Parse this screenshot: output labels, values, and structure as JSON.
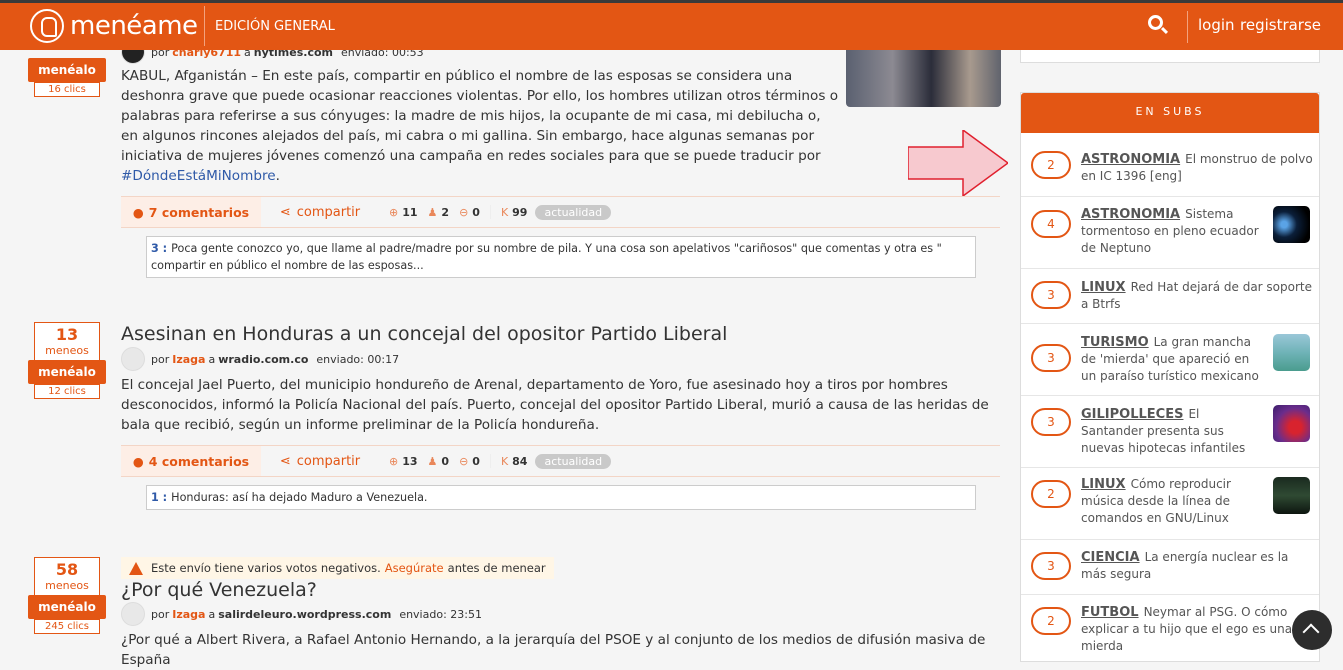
{
  "header": {
    "logo_text": "menéame",
    "edition": "EDICIÓN GENERAL",
    "login": "login",
    "register": "registrarse"
  },
  "stories": [
    {
      "menealo": "menéalo",
      "clicks": "16 clics",
      "meta_by": "por",
      "user": "charly6711",
      "to": "a",
      "site": "nytimes.com",
      "sent": "enviado: 00:53",
      "body": "KABUL, Afganistán – En este país, compartir en público el nombre de las esposas se considera una deshonra grave que puede ocasionar reacciones violentas. Por ello, los hombres utilizan otros términos o palabras para referirse a sus cónyuges: la madre de mis hijos, la ocupante de mi casa, mi debilucha o, en algunos rincones alejados del país, mi cabra o mi gallina. Sin embargo, hace algunas semanas por iniciativa de mujeres jóvenes comenzó una campaña en redes sociales para que se puede traducir por",
      "hashtag": "#DóndeEstáMiNombre",
      "after_hashtag": ".",
      "comments": "7 comentarios",
      "share": "compartir",
      "up": "11",
      "anon": "2",
      "neg": "0",
      "karma_label": "K",
      "karma": "99",
      "category": "actualidad",
      "excerpt_num": "3 :",
      "excerpt": "Poca gente conozco yo, que llame al padre/madre por su nombre de pila. Y una cosa son apelativos \"cariñosos\" que comentas y otra es \" compartir en público el nombre de las esposas..."
    },
    {
      "votes": "13",
      "votes_label": "meneos",
      "menealo": "menéalo",
      "clicks": "12 clics",
      "title": "Asesinan en Honduras a un concejal del opositor Partido Liberal",
      "meta_by": "por",
      "user": "Izaga",
      "to": "a",
      "site": "wradio.com.co",
      "sent": "enviado: 00:17",
      "body": "El concejal Jael Puerto, del municipio hondureño de Arenal, departamento de Yoro, fue asesinado hoy a tiros por hombres desconocidos, informó la Policía Nacional del país. Puerto, concejal del opositor Partido Liberal, murió a causa de las heridas de bala que recibió, según un informe preliminar de la Policía hondureña.",
      "comments": "4 comentarios",
      "share": "compartir",
      "up": "13",
      "anon": "0",
      "neg": "0",
      "karma_label": "K",
      "karma": "84",
      "category": "actualidad",
      "excerpt_num": "1 :",
      "excerpt": "Honduras: así ha dejado Maduro a Venezuela."
    },
    {
      "votes": "58",
      "votes_label": "meneos",
      "menealo": "menéalo",
      "clicks": "245 clics",
      "warning_pre": "Este envío tiene varios votos negativos.",
      "warning_link": "Asegúrate",
      "warning_post": "antes de menear",
      "title": "¿Por qué Venezuela?",
      "meta_by": "por",
      "user": "Izaga",
      "to": "a",
      "site": "salirdeleuro.wordpress.com",
      "sent": "enviado: 23:51",
      "body": "¿Por qué a Albert Rivera, a Rafael Antonio Hernando, a la jerarquía del PSOE y al conjunto de los medios de difusión masiva de España"
    }
  ],
  "sidebar": {
    "subs_title": "EN SUBS",
    "items": [
      {
        "count": "2",
        "sub": "ASTRONOMIA",
        "text": "El monstruo de polvo en IC 1396 [eng]"
      },
      {
        "count": "4",
        "sub": "ASTRONOMIA",
        "text": "Sistema tormentoso en pleno ecuador de Neptuno"
      },
      {
        "count": "3",
        "sub": "LINUX",
        "text": "Red Hat dejará de dar soporte a Btrfs"
      },
      {
        "count": "3",
        "sub": "TURISMO",
        "text": "La gran mancha de 'mierda' que apareció en un paraíso turístico mexicano"
      },
      {
        "count": "3",
        "sub": "GILIPOLLECES",
        "text": "El Santander presenta sus nuevas hipotecas infantiles"
      },
      {
        "count": "2",
        "sub": "LINUX",
        "text": "Cómo reproducir música desde la línea de comandos en GNU/Linux"
      },
      {
        "count": "3",
        "sub": "CIENCIA",
        "text": "La energía nuclear es la más segura"
      },
      {
        "count": "2",
        "sub": "FUTBOL",
        "text": "Neymar al PSG. O cómo explicar a tu hijo que el ego es una mierda"
      }
    ]
  },
  "icons": {
    "comments": "speech-bubble-icon",
    "share": "share-icon",
    "up": "arrow-up-circle-icon",
    "anon": "anonymous-user-icon",
    "neg": "arrow-down-circle-icon",
    "warning": "warning-triangle-icon",
    "search": "search-icon",
    "scroll_top": "chevron-up-icon"
  },
  "colors": {
    "brand": "#e35614",
    "link": "#2f5aa8",
    "category": "#c9c9c9"
  }
}
